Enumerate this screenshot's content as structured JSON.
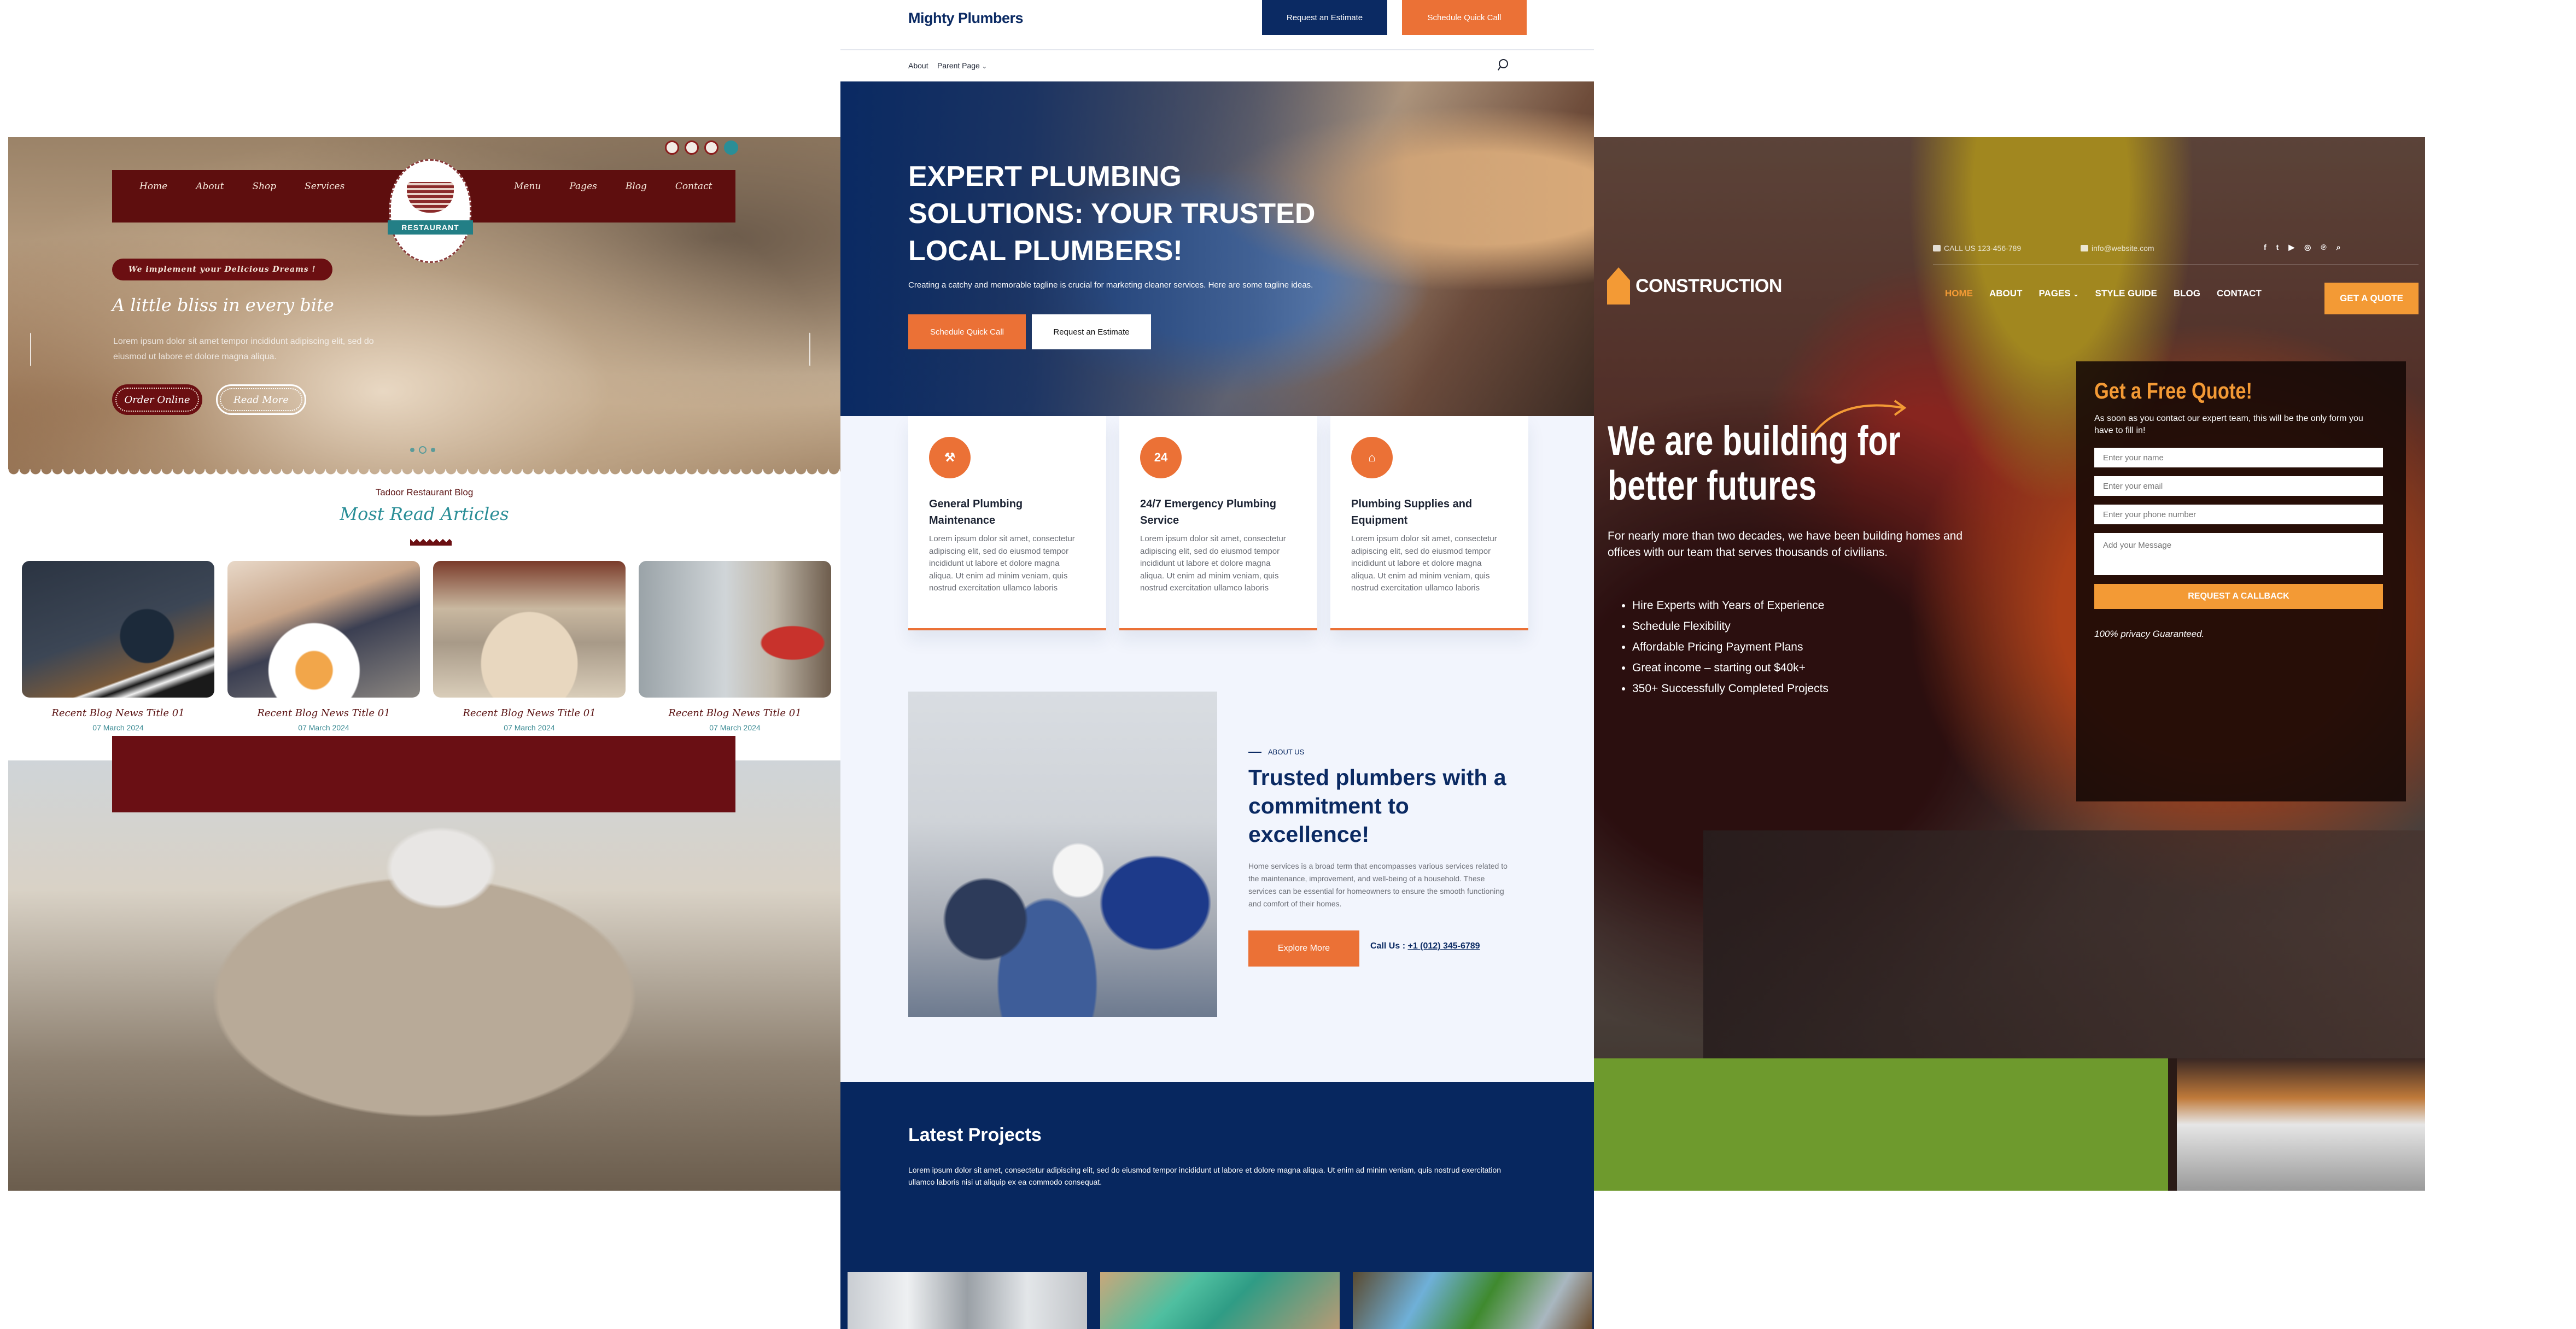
{
  "restaurant": {
    "nav_left": [
      "Home",
      "About",
      "Shop",
      "Services"
    ],
    "nav_right": [
      "Menu",
      "Pages",
      "Blog",
      "Contact"
    ],
    "logo_badge": "RESTAURANT",
    "hero": {
      "tagline": "We implement your Delicious Dreams !",
      "headline": "A little bliss in every bite",
      "description": "Lorem ipsum dolor sit amet tempor incididunt adipiscing elit, sed do eiusmod ut labore et dolore magna aliqua.",
      "order_button": "Order Online",
      "read_more_button": "Read More",
      "slide_count": 3,
      "active_slide": 2
    },
    "blog": {
      "kicker": "Tadoor Restaurant Blog",
      "title": "Most Read Articles",
      "posts": [
        {
          "title": "Recent Blog News Title 01",
          "date": "07 March 2024"
        },
        {
          "title": "Recent Blog News Title 01",
          "date": "07 March 2024"
        },
        {
          "title": "Recent Blog News Title 01",
          "date": "07 March 2024"
        },
        {
          "title": "Recent Blog News Title 01",
          "date": "07 March 2024"
        }
      ]
    }
  },
  "plumbing": {
    "brand": "Mighty Plumbers",
    "header_buttons": {
      "estimate": "Request an Estimate",
      "call": "Schedule Quick Call"
    },
    "nav": {
      "about": "About",
      "parent_page": "Parent Page",
      "parent_caret": "⌄"
    },
    "hero": {
      "title": "EXPERT PLUMBING SOLUTIONS: YOUR TRUSTED LOCAL PLUMBERS!",
      "subtitle": "Creating a catchy and memorable tagline is crucial for marketing cleaner services. Here are some tagline ideas.",
      "call_button": "Schedule Quick Call",
      "estimate_button": "Request an Estimate"
    },
    "services": [
      {
        "icon": "wrench-pipe-icon",
        "glyph": "⚒",
        "title": "General Plumbing Maintenance",
        "text": "Lorem ipsum dolor sit amet, consectetur adipiscing elit, sed do eiusmod tempor incididunt ut labore et dolore magna aliqua. Ut enim ad minim veniam, quis nostrud exercitation ullamco laboris"
      },
      {
        "icon": "24-hour-icon",
        "glyph": "24",
        "title": "24/7 Emergency Plumbing Service",
        "text": "Lorem ipsum dolor sit amet, consectetur adipiscing elit, sed do eiusmod tempor incididunt ut labore et dolore magna aliqua. Ut enim ad minim veniam, quis nostrud exercitation ullamco laboris"
      },
      {
        "icon": "house-pipe-icon",
        "glyph": "⌂",
        "title": "Plumbing Supplies and Equipment",
        "text": "Lorem ipsum dolor sit amet, consectetur adipiscing elit, sed do eiusmod tempor incididunt ut labore et dolore magna aliqua. Ut enim ad minim veniam, quis nostrud exercitation ullamco laboris"
      }
    ],
    "about": {
      "kicker": "ABOUT US",
      "title": "Trusted plumbers with a commitment to excellence!",
      "description": "Home services is a broad term that encompasses various services related to the maintenance, improvement, and well-being of a household. These services can be essential for homeowners to ensure the smooth functioning and comfort of their homes.",
      "explore_button": "Explore More",
      "call_label": "Call Us :",
      "phone": "+1 (012) 345-6789"
    },
    "projects": {
      "title": "Latest Projects",
      "description": "Lorem ipsum dolor sit amet, consectetur adipiscing elit, sed do eiusmod tempor incididunt ut labore et dolore magna aliqua. Ut enim ad minim veniam, quis nostrud exercitation ullamco laboris nisi ut aliquip ex ea commodo consequat."
    },
    "colors": {
      "navy": "#0b2a63",
      "orange": "#eb7136",
      "background": "#f2f5fd"
    }
  },
  "construction": {
    "phone": "CALL US 123-456-789",
    "email": "info@website.com",
    "social": [
      "f",
      "t",
      "▶",
      "◎",
      "℗"
    ],
    "logo": "CONSTRUCTION",
    "nav": [
      "HOME",
      "ABOUT",
      "PAGES",
      "STYLE GUIDE",
      "BLOG",
      "CONTACT"
    ],
    "nav_active": "HOME",
    "pages_caret": "⌄",
    "cta": "GET A QUOTE",
    "headline": "We are building for better futures",
    "description": "For nearly more than two decades, we have been building homes and offices with our team that serves thousands of civilians.",
    "features": [
      "Hire Experts with Years of Experience",
      "Schedule Flexibility",
      "Affordable Pricing Payment Plans",
      "Great income – starting out $40k+",
      "350+ Successfully Completed Projects"
    ],
    "form": {
      "title": "Get a Free Quote!",
      "subtitle": "As soon as you contact our expert team, this will be the only form you have to fill in!",
      "name_placeholder": "Enter your name",
      "email_placeholder": "Enter your email",
      "phone_placeholder": "Enter your phone number",
      "message_placeholder": "Add your Message",
      "submit": "REQUEST A CALLBACK",
      "privacy": "100% privacy Guaranteed."
    },
    "colors": {
      "accent": "#f39a35"
    }
  }
}
